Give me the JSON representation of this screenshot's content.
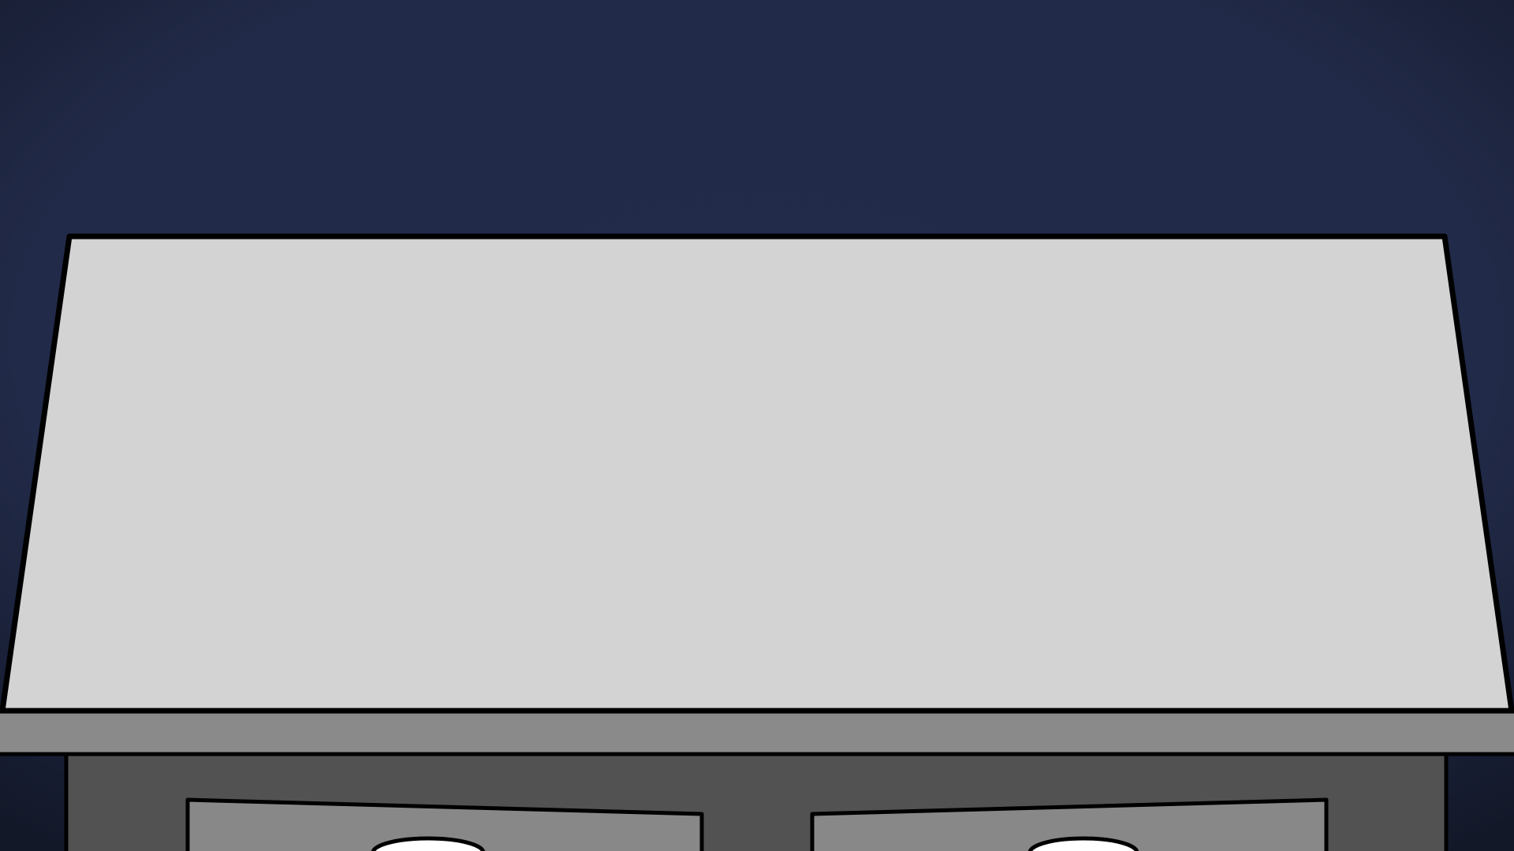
{
  "scene": {
    "name": "desk-scene",
    "colors": {
      "sky_center": "#232b4b",
      "sky_edge": "#151a2c",
      "desk_top": "#d3d3d3",
      "desk_lip": "#8a8a8a",
      "desk_body": "#525252",
      "drawer": "#888888",
      "knob": "#ffffff",
      "outline": "#000000"
    },
    "elements": [
      "night-background",
      "desk-top-surface",
      "desk-front-edge",
      "desk-body",
      "left-drawer",
      "right-drawer",
      "left-drawer-knob",
      "right-drawer-knob"
    ]
  }
}
